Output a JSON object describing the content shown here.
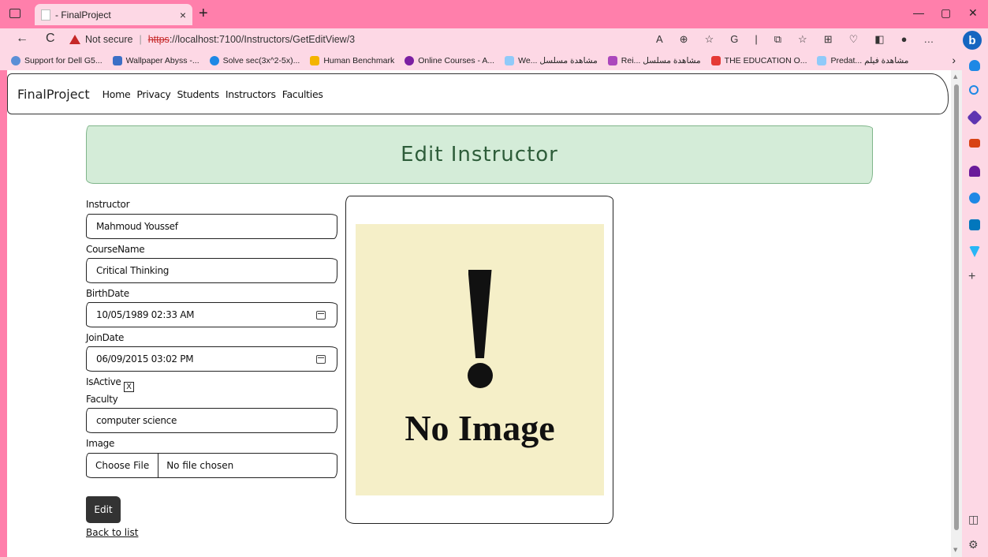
{
  "browser": {
    "tab_title": "- FinalProject",
    "tab_close": "×",
    "new_tab": "+",
    "window_controls": [
      "—",
      "▢",
      "✕"
    ],
    "nav": {
      "back": "←",
      "reload": "C"
    },
    "address": {
      "not_secure": "Not secure",
      "separator": "|",
      "scheme": "https",
      "rest": "://localhost:7100/Instructors/GetEditView/3"
    },
    "toolbar_icons": [
      "A",
      "⊕",
      "☆",
      "G",
      "|",
      "⧉",
      "☆",
      "⊞",
      "♡",
      "◧",
      "●",
      "…"
    ],
    "bing_label": "b",
    "bookmarks": [
      {
        "label": "Support for Dell G5...",
        "color": "#5b8fd6"
      },
      {
        "label": "Wallpaper Abyss -...",
        "color": "#3b6fc6"
      },
      {
        "label": "Solve sec(3x^2-5x)...",
        "color": "#1e88e5"
      },
      {
        "label": "Human Benchmark",
        "color": "#f4b400"
      },
      {
        "label": "Online Courses - A...",
        "color": "#7b1fa2"
      },
      {
        "label": "We... مشاهدة مسلسل",
        "color": "#90caf9"
      },
      {
        "label": "Rei... مشاهدة مسلسل",
        "color": "#ab47bc"
      },
      {
        "label": "THE EDUCATION O...",
        "color": "#e53935"
      },
      {
        "label": "Predat... مشاهدة فيلم",
        "color": "#90caf9"
      }
    ],
    "bookmarks_more": "›",
    "sidebar_icons": [
      {
        "name": "notification-icon",
        "color": "#1e88e5"
      },
      {
        "name": "search-icon",
        "color": "#1e88e5"
      },
      {
        "name": "tag-icon",
        "color": "#5e35b1"
      },
      {
        "name": "briefcase-icon",
        "color": "#d84315"
      },
      {
        "name": "people-icon",
        "color": "#6a1b9a"
      },
      {
        "name": "office-icon",
        "color": "#1e88e5"
      },
      {
        "name": "outlook-icon",
        "color": "#0277bd"
      },
      {
        "name": "send-icon",
        "color": "#29b6f6"
      }
    ],
    "sidebar_add": "+",
    "sidebar_bottom": [
      "◫",
      "⚙"
    ]
  },
  "navbar": {
    "brand": "FinalProject",
    "links": [
      "Home",
      "Privacy",
      "Students",
      "Instructors",
      "Faculties"
    ]
  },
  "page": {
    "title": "Edit Instructor",
    "fields": {
      "instructor": {
        "label": "Instructor",
        "value": "Mahmoud Youssef"
      },
      "course": {
        "label": "CourseName",
        "value": "Critical Thinking"
      },
      "birth": {
        "label": "BirthDate",
        "value": "10/05/1989 02:33 AM"
      },
      "join": {
        "label": "JoinDate",
        "value": "06/09/2015 03:02 PM"
      },
      "active": {
        "label": "IsActive",
        "mark": "X"
      },
      "faculty": {
        "label": "Faculty",
        "value": "computer science"
      },
      "image": {
        "label": "Image",
        "button": "Choose File",
        "status": "No file chosen"
      }
    },
    "edit_button": "Edit",
    "back_link": "Back to list",
    "no_image_text": "No Image"
  }
}
